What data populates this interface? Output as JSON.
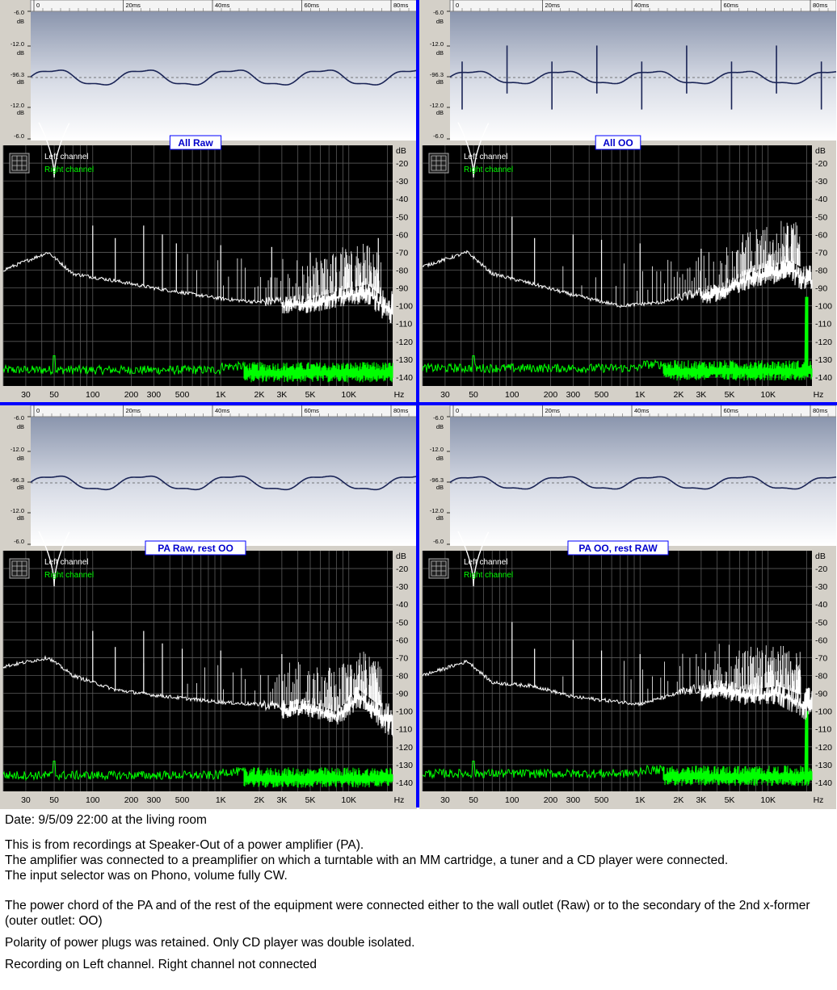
{
  "colors": {
    "left_channel": "#ffffff",
    "right_channel": "#00ff00",
    "waveform": "#1a2456",
    "spectrum_bg": "#000000",
    "grid": "#5a5a5a",
    "divider": "#0000ff",
    "label_text": "#0000cc"
  },
  "chart_data": [
    {
      "type": "line",
      "title": "All Raw",
      "legend": [
        "Left channel",
        "Right channel"
      ],
      "waveform": {
        "time_ticks": [
          "0",
          "20ms",
          "40ms",
          "60ms",
          "80ms"
        ],
        "db_ticks": [
          "-6.0",
          "dB",
          "-12.0",
          "dB",
          "-96.3",
          "dB",
          "-12.0",
          "dB",
          "-6.0"
        ],
        "cycles": 4.3,
        "amplitude": 0.12,
        "spike_amplitude": 0.0
      },
      "spectrum": {
        "x_ticks": [
          "30",
          "50",
          "100",
          "200",
          "300",
          "500",
          "1K",
          "2K",
          "3K",
          "5K",
          "10K",
          "Hz"
        ],
        "y_ticks": [
          "dB",
          "-20",
          "-30",
          "-40",
          "-50",
          "-60",
          "-70",
          "-80",
          "-90",
          "-100",
          "-110",
          "-120",
          "-130",
          "-140"
        ],
        "xlim_hz": [
          20,
          22000
        ],
        "ylim_db": [
          -145,
          -10
        ],
        "left_floor": [
          [
            20,
            -80
          ],
          [
            45,
            -70
          ],
          [
            70,
            -82
          ],
          [
            150,
            -86
          ],
          [
            300,
            -90
          ],
          [
            1000,
            -96
          ],
          [
            2000,
            -98
          ],
          [
            5000,
            -96
          ],
          [
            10000,
            -90
          ],
          [
            14000,
            -88
          ],
          [
            20000,
            -97
          ]
        ],
        "left_peaks": [
          [
            50,
            -28
          ],
          [
            100,
            -55
          ],
          [
            150,
            -62
          ],
          [
            250,
            -55
          ],
          [
            350,
            -60
          ],
          [
            450,
            -65
          ],
          [
            1000,
            -66
          ],
          [
            2500,
            -67
          ],
          [
            5000,
            -70
          ],
          [
            17000,
            -62
          ]
        ],
        "right_floor_db": -136,
        "right_peaks": [
          [
            50,
            -128
          ]
        ]
      }
    },
    {
      "type": "line",
      "title": "All OO",
      "legend": [
        "Left channel",
        "Right channel"
      ],
      "waveform": {
        "time_ticks": [
          "0",
          "20ms",
          "40ms",
          "60ms",
          "80ms"
        ],
        "db_ticks": [
          "-6.0",
          "dB",
          "-12.0",
          "dB",
          "-96.3",
          "dB",
          "-12.0",
          "dB",
          "-6.0"
        ],
        "cycles": 4.3,
        "amplitude": 0.1,
        "spike_amplitude": 0.55
      },
      "spectrum": {
        "x_ticks": [
          "30",
          "50",
          "100",
          "200",
          "300",
          "500",
          "1K",
          "2K",
          "3K",
          "5K",
          "10K",
          "Hz"
        ],
        "y_ticks": [
          "dB",
          "-20",
          "-30",
          "-40",
          "-50",
          "-60",
          "-70",
          "-80",
          "-90",
          "-100",
          "-110",
          "-120",
          "-130",
          "-140"
        ],
        "xlim_hz": [
          20,
          22000
        ],
        "ylim_db": [
          -145,
          -10
        ],
        "left_floor": [
          [
            20,
            -78
          ],
          [
            45,
            -70
          ],
          [
            70,
            -82
          ],
          [
            150,
            -88
          ],
          [
            300,
            -94
          ],
          [
            700,
            -100
          ],
          [
            1500,
            -98
          ],
          [
            4000,
            -90
          ],
          [
            8000,
            -80
          ],
          [
            15000,
            -75
          ],
          [
            20000,
            -80
          ]
        ],
        "left_peaks": [
          [
            50,
            -28
          ],
          [
            100,
            -50
          ],
          [
            150,
            -62
          ],
          [
            300,
            -60
          ],
          [
            500,
            -63
          ],
          [
            1000,
            -65
          ],
          [
            3000,
            -68
          ]
        ],
        "right_floor_db": -135,
        "right_peaks": [
          [
            50,
            -128
          ],
          [
            20000,
            -95
          ]
        ]
      }
    },
    {
      "type": "line",
      "title": "PA Raw, rest OO",
      "legend": [
        "Left channel",
        "Right channel"
      ],
      "waveform": {
        "time_ticks": [
          "0",
          "20ms",
          "40ms",
          "60ms",
          "80ms"
        ],
        "db_ticks": [
          "-6.0",
          "dB",
          "-12.0",
          "dB",
          "-96.3",
          "dB",
          "-12.0",
          "dB",
          "-6.0"
        ],
        "cycles": 4.3,
        "amplitude": 0.11,
        "spike_amplitude": 0.0
      },
      "spectrum": {
        "x_ticks": [
          "30",
          "50",
          "100",
          "200",
          "300",
          "500",
          "1K",
          "2K",
          "3K",
          "5K",
          "10K",
          "Hz"
        ],
        "y_ticks": [
          "dB",
          "-20",
          "-30",
          "-40",
          "-50",
          "-60",
          "-70",
          "-80",
          "-90",
          "-100",
          "-110",
          "-120",
          "-130",
          "-140"
        ],
        "xlim_hz": [
          20,
          22000
        ],
        "ylim_db": [
          -145,
          -10
        ],
        "left_floor": [
          [
            20,
            -75
          ],
          [
            45,
            -70
          ],
          [
            70,
            -80
          ],
          [
            150,
            -88
          ],
          [
            300,
            -91
          ],
          [
            1000,
            -95
          ],
          [
            3000,
            -97
          ],
          [
            5000,
            -95
          ],
          [
            8000,
            -100
          ],
          [
            12000,
            -88
          ],
          [
            20000,
            -100
          ]
        ],
        "left_peaks": [
          [
            50,
            -30
          ],
          [
            100,
            -55
          ],
          [
            150,
            -64
          ],
          [
            250,
            -55
          ],
          [
            350,
            -62
          ],
          [
            500,
            -65
          ],
          [
            1000,
            -66
          ],
          [
            3000,
            -68
          ]
        ],
        "right_floor_db": -136,
        "right_peaks": [
          [
            50,
            -128
          ]
        ]
      }
    },
    {
      "type": "line",
      "title": "PA OO, rest RAW",
      "legend": [
        "Left channel",
        "Right channel"
      ],
      "waveform": {
        "time_ticks": [
          "0",
          "20ms",
          "40ms",
          "60ms",
          "80ms"
        ],
        "db_ticks": [
          "-6.0",
          "dB",
          "-12.0",
          "dB",
          "-96.3",
          "dB",
          "-12.0",
          "dB",
          "-6.0"
        ],
        "cycles": 4.3,
        "amplitude": 0.1,
        "spike_amplitude": 0.0
      },
      "spectrum": {
        "x_ticks": [
          "30",
          "50",
          "100",
          "200",
          "300",
          "500",
          "1K",
          "2K",
          "3K",
          "5K",
          "10K",
          "Hz"
        ],
        "y_ticks": [
          "dB",
          "-20",
          "-30",
          "-40",
          "-50",
          "-60",
          "-70",
          "-80",
          "-90",
          "-100",
          "-110",
          "-120",
          "-130",
          "-140"
        ],
        "xlim_hz": [
          20,
          22000
        ],
        "ylim_db": [
          -145,
          -10
        ],
        "left_floor": [
          [
            20,
            -80
          ],
          [
            45,
            -72
          ],
          [
            70,
            -84
          ],
          [
            150,
            -86
          ],
          [
            300,
            -92
          ],
          [
            1000,
            -96
          ],
          [
            2000,
            -90
          ],
          [
            4000,
            -85
          ],
          [
            7000,
            -88
          ],
          [
            12000,
            -86
          ],
          [
            20000,
            -92
          ]
        ],
        "left_peaks": [
          [
            50,
            -30
          ],
          [
            100,
            -50
          ],
          [
            150,
            -65
          ],
          [
            300,
            -60
          ],
          [
            500,
            -66
          ],
          [
            1000,
            -68
          ],
          [
            15000,
            -72
          ]
        ],
        "right_floor_db": -135,
        "right_peaks": [
          [
            50,
            -128
          ],
          [
            20000,
            -100
          ]
        ]
      }
    }
  ],
  "notes": {
    "date": "Date: 9/5/09 22:00 at the living room",
    "p1": "This is from recordings at Speaker-Out of a power amplifier (PA).",
    "p2": "The amplifier was connected to a preamplifier on which a turntable with an MM cartridge, a tuner  and a CD player were connected.",
    "p3": "The input selector was on Phono, volume fully CW.",
    "p4": "The power chord of the PA and of the rest of the equipment were connected either to the wall outlet (Raw) or to the secondary of the 2nd x-former (outer outlet: OO)",
    "p5": "Polarity of power plugs was retained. Only CD player was double isolated.",
    "p6": "Recording on Left channel. Right channel not connected"
  }
}
